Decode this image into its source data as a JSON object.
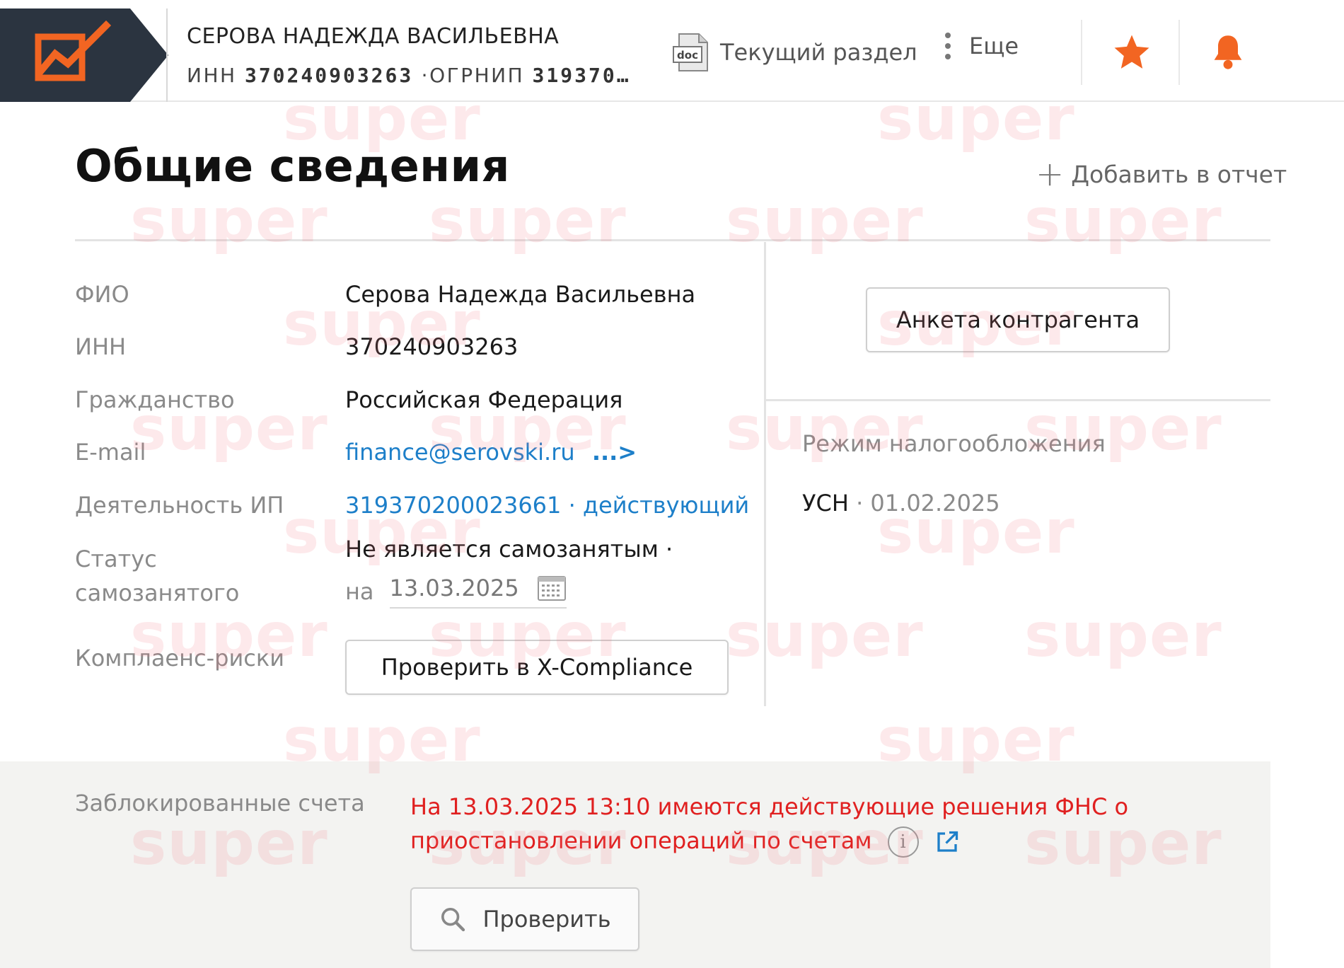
{
  "header": {
    "company_name": "СЕРОВА НАДЕЖДА ВАСИЛЬЕВНА",
    "inn_label": "ИНН",
    "inn_value": "370240903263",
    "ogrnip_label": "ОГРНИП",
    "ogrnip_value": "319370…",
    "current_section_label": "Текущий раздел",
    "doc_icon_text": "doc",
    "more_label": "Еще",
    "colors": {
      "accent": "#f26522",
      "logo_bg": "#2b3440"
    }
  },
  "page": {
    "title": "Общие сведения",
    "add_report_label": "Добавить в отчет"
  },
  "info": {
    "fio_label": "ФИО",
    "fio_value": "Серова Надежда Васильевна",
    "inn_label": "ИНН",
    "inn_value": "370240903263",
    "citizenship_label": "Гражданство",
    "citizenship_value": "Российская Федерация",
    "email_label": "E-mail",
    "email_value": "finance@serovski.ru",
    "email_more": "...>",
    "activity_label": "Деятельность ИП",
    "activity_value": "319370200023661 · действующий",
    "selfemployed_label_line1": "Статус",
    "selfemployed_label_line2": "самозанятого",
    "selfemployed_value": "Не является самозанятым ·",
    "date_prefix": "на",
    "date_value": "13.03.2025",
    "compliance_label": "Комплаенс-риски",
    "compliance_button": "Проверить в X-Compliance"
  },
  "right": {
    "anketa_button": "Анкета контрагента",
    "tax_label": "Режим налогообложения",
    "tax_value": "УСН",
    "tax_separator": "·",
    "tax_date": "01.02.2025"
  },
  "blocked": {
    "label": "Заблокированные счета",
    "message": "На 13.03.2025 13:10 имеются действующие решения ФНС о приостановлении операций по счетам",
    "info_glyph": "i",
    "check_button": "Проверить",
    "message_color": "#e02020"
  },
  "watermark": {
    "text": "super"
  }
}
